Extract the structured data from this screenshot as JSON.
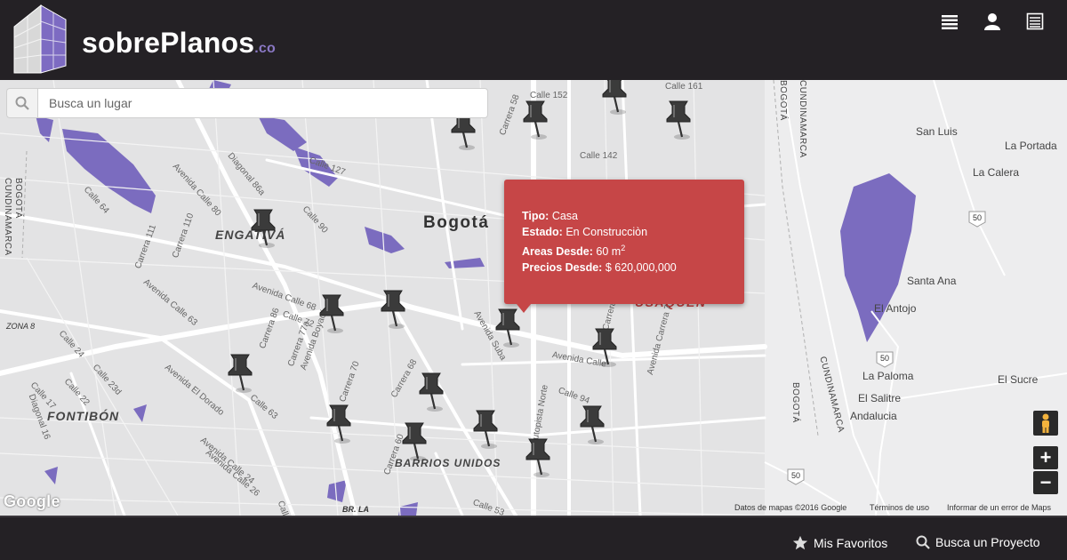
{
  "header": {
    "brand": "sobrePlanos",
    "brand_tld": ".co",
    "icons": [
      "list-icon",
      "user-icon",
      "grid-icon"
    ]
  },
  "search": {
    "placeholder": "Busca un lugar",
    "icon": "search-icon"
  },
  "map": {
    "labels": {
      "bogota": "Bogotá",
      "engativa": "ENGATIVÁ",
      "fontibon": "FONTIBÓN",
      "barrios_unidos": "BARRIOS UNIDOS",
      "usaquen": "USAQUÉN",
      "zona8": "ZONA 8",
      "br_la": "BR. LA",
      "san_luis": "San Luis",
      "la_portada": "La Portada",
      "la_calera": "La Calera",
      "santa_ana": "Santa Ana",
      "el_antojo": "El Antojo",
      "la_paloma": "La Paloma",
      "el_salitre": "El Salitre",
      "andalucia": "Andalucia",
      "el_sucre": "El Sucre",
      "bogota_vert_left": "BOGOTÁ",
      "cundinamarca_left": "CUNDINAMARCA",
      "bogota_vert_right": "BOGOTÁ",
      "cundinamarca_right": "CUNDINAMARCA",
      "bogota_vert_right2": "BOGOTÁ",
      "cundinamarca_right2": "CUNDINAMARCA",
      "route_50a": "50",
      "route_50b": "50",
      "route_50c": "50"
    },
    "streets": {
      "av_calle_80": "Avenida Calle 80",
      "diagonal_86a": "Diagonal 86a",
      "calle_90": "Calle 90",
      "calle_127": "Calle 127",
      "carrera_58": "Carrera 58",
      "calle_152": "Calle 152",
      "calle_161": "Calle 161",
      "calle_142": "Calle 142",
      "carrera_111": "Carrera 111",
      "carrera_110": "Carrera 110",
      "av_calle_63": "Avenida Calle 63",
      "av_calle_68": "Avenida Calle 68",
      "calle_72": "Calle 72",
      "carrera_86": "Carrera 86",
      "carrera_77a": "Carrera 77a",
      "carrera_70": "Carrera 70",
      "carrera_68": "Carrera 68",
      "av_el_dorado": "Avenida El Dorado",
      "av_boyaca": "Avenida Boyacá",
      "calle_24": "Calle 24",
      "calle_23d": "Calle 23d",
      "calle_22": "Calle 22",
      "calle_17": "Calle 17",
      "diagonal_16": "Diagonal 16",
      "av_calle_26": "Avenida Calle 26",
      "carrera_60": "Carrera 60",
      "calle_53": "Calle 53",
      "calle_94": "Calle 94",
      "autopista_norte": "Autopista Norte",
      "av_carrera_7": "Avenida Carrera 7",
      "avenida_calle": "Avenida Calle",
      "av_suba": "Avenida Suba",
      "carrera_15": "Carrera 15",
      "calle_19": "Calle 19",
      "calle_64": "Calle 64",
      "calle_63": "Calle 63",
      "av_calle_24": "Avenida Calle 24",
      "calle_127b": "Calle 12",
      "calle_138": "Calle 138"
    },
    "popup": {
      "tipo_label": "Tipo:",
      "tipo_value": "Casa",
      "estado_label": "Estado:",
      "estado_value": "En Construcciòn",
      "areas_label": "Areas Desde:",
      "areas_value": "60 m",
      "areas_unit_sup": "2",
      "precios_label": "Precios Desde:",
      "precios_value": "$ 620,000,000"
    },
    "pins_count_shown": 20,
    "controls": {
      "zoom_in": "+",
      "zoom_out": "−",
      "pegman_icon": "pegman-icon"
    },
    "attribution": {
      "google": "Google",
      "datos": "Datos de mapas ©2016 Google",
      "terminos": "Términos de uso",
      "error": "Informar de un error de Maps"
    }
  },
  "footer": {
    "favoritos": "Mis Favoritos",
    "buscar": "Busca un Proyecto"
  },
  "colors": {
    "header_bg": "#242125",
    "popup_bg": "#c64647",
    "water": "#7b6cbf",
    "brand_accent": "#8a78c4"
  }
}
